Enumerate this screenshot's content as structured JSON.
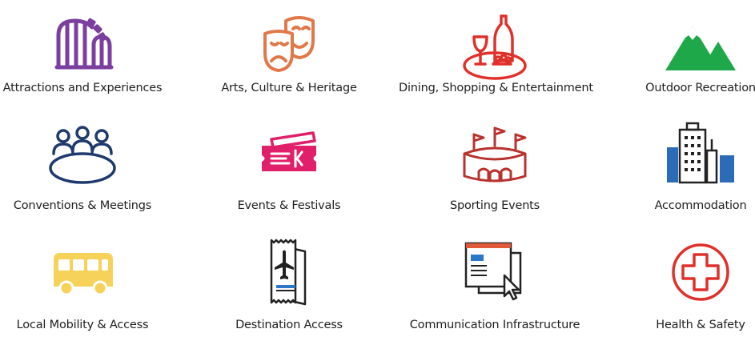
{
  "categories": [
    {
      "label": "Attractions and Experiences",
      "icon": "roller-coaster-icon",
      "color": "#7b3fa0"
    },
    {
      "label": "Arts, Culture & Heritage",
      "icon": "theatre-masks-icon",
      "color": "#e0784a"
    },
    {
      "label": "Dining, Shopping & Entertainment",
      "icon": "wine-and-dinner-icon",
      "color": "#e0302a"
    },
    {
      "label": "Outdoor Recreation",
      "icon": "mountains-icon",
      "color": "#1fa84a"
    },
    {
      "label": "Conventions & Meetings",
      "icon": "meeting-table-icon",
      "color": "#1f3a6e"
    },
    {
      "label": "Events & Festivals",
      "icon": "ticket-icon",
      "color": "#e0206a"
    },
    {
      "label": "Sporting Events",
      "icon": "stadium-icon",
      "color": "#b8322e"
    },
    {
      "label": "Accommodation",
      "icon": "buildings-icon",
      "color": "#2a6cb8"
    },
    {
      "label": "Local Mobility & Access",
      "icon": "bus-icon",
      "color": "#f6d25a"
    },
    {
      "label": "Destination Access",
      "icon": "boarding-pass-icon",
      "color": "#2a78c8"
    },
    {
      "label": "Communication Infrastructure",
      "icon": "browser-window-icon",
      "color": "#e05a3a"
    },
    {
      "label": "Health & Safety",
      "icon": "first-aid-cross-icon",
      "color": "#e0302a"
    }
  ]
}
